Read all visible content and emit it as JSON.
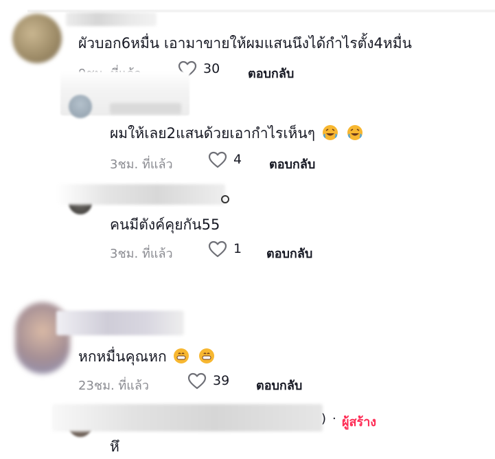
{
  "comments": [
    {
      "text": "ผัวบอก6หมื่น เอามาขายให้ผมแสนนึงได้กำไรตั้ง4หมื่น",
      "time": "9ชม. ที่แล้ว",
      "likes": "30",
      "reply_label": "ตอบกลับ"
    },
    {
      "text": "ผมให้เลย2แสนด้วยเอากำไรเห็นๆ",
      "time": "3ชม. ที่แล้ว",
      "likes": "4",
      "reply_label": "ตอบกลับ",
      "emoji": "rolling-laughing-emoji"
    },
    {
      "text": "คนมีตังค์คุยกัน55",
      "time": "3ชม. ที่แล้ว",
      "likes": "1",
      "reply_label": "ตอบกลับ"
    },
    {
      "text": "หกหมื่นคุณหก",
      "time": "23ชม. ที่แล้ว",
      "likes": "39",
      "reply_label": "ตอบกลับ",
      "emoji": "grinning-emoji"
    },
    {
      "text": "หึ",
      "author_suffix": ")",
      "separator": "·",
      "creator_badge": "ผู้สร้าง"
    }
  ],
  "colors": {
    "muted": "#8a8b91",
    "creator": "#fe2c55",
    "emoji": "#f7b731"
  }
}
